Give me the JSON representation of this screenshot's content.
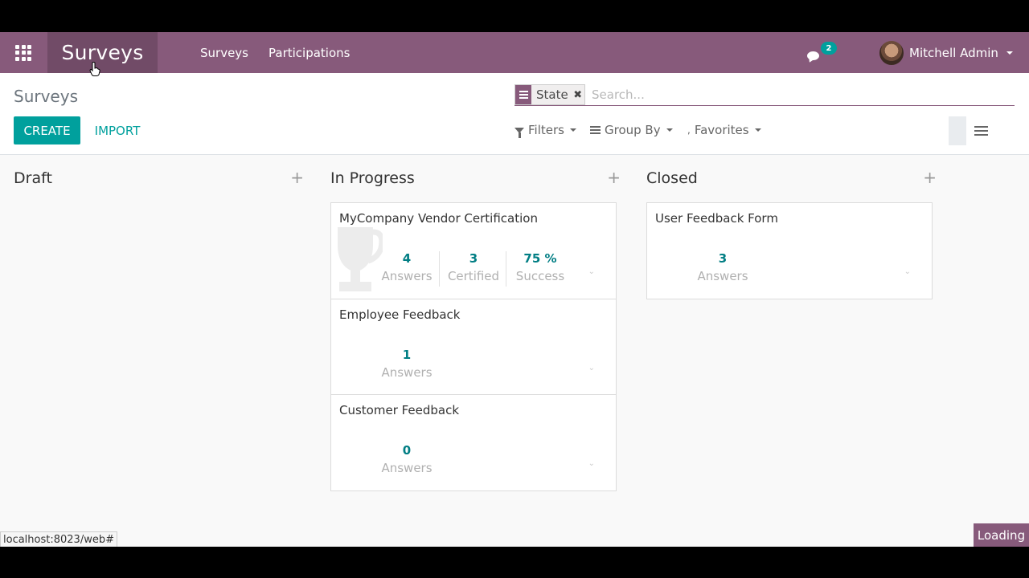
{
  "navbar": {
    "brand": "Surveys",
    "menu": [
      "Surveys",
      "Participations"
    ],
    "chat_count": "2",
    "user_name": "Mitchell Admin",
    "color": "#875A7B"
  },
  "control_panel": {
    "breadcrumb": "Surveys",
    "create_label": "CREATE",
    "import_label": "IMPORT",
    "facet_label": "State",
    "search_placeholder": "Search...",
    "filters_label": "Filters",
    "groupby_label": "Group By",
    "favorites_label": "Favorites"
  },
  "kanban": {
    "columns": [
      {
        "title": "Draft",
        "cards": []
      },
      {
        "title": "In Progress",
        "cards": [
          {
            "title": "MyCompany Vendor Certification",
            "stats": [
              {
                "value": "4",
                "label": "Answers"
              },
              {
                "value": "3",
                "label": "Certified"
              },
              {
                "value": "75 %",
                "label": "Success"
              }
            ]
          },
          {
            "title": "Employee Feedback",
            "stats": [
              {
                "value": "1",
                "label": "Answers"
              }
            ]
          },
          {
            "title": "Customer Feedback",
            "stats": [
              {
                "value": "0",
                "label": "Answers"
              }
            ]
          }
        ]
      },
      {
        "title": "Closed",
        "cards": [
          {
            "title": "User Feedback Form",
            "stats": [
              {
                "value": "3",
                "label": "Answers"
              }
            ]
          }
        ]
      }
    ],
    "add_symbol": "+"
  },
  "status_bar": {
    "url": "localhost:8023/web#",
    "loading": "Loading"
  },
  "icons": [
    "apps-grid-icon",
    "chat-icon",
    "funnel-icon",
    "bars-icon",
    "star-icon",
    "list-view-icon",
    "trophy-icon",
    "close-icon"
  ],
  "accent": "#00A09D"
}
